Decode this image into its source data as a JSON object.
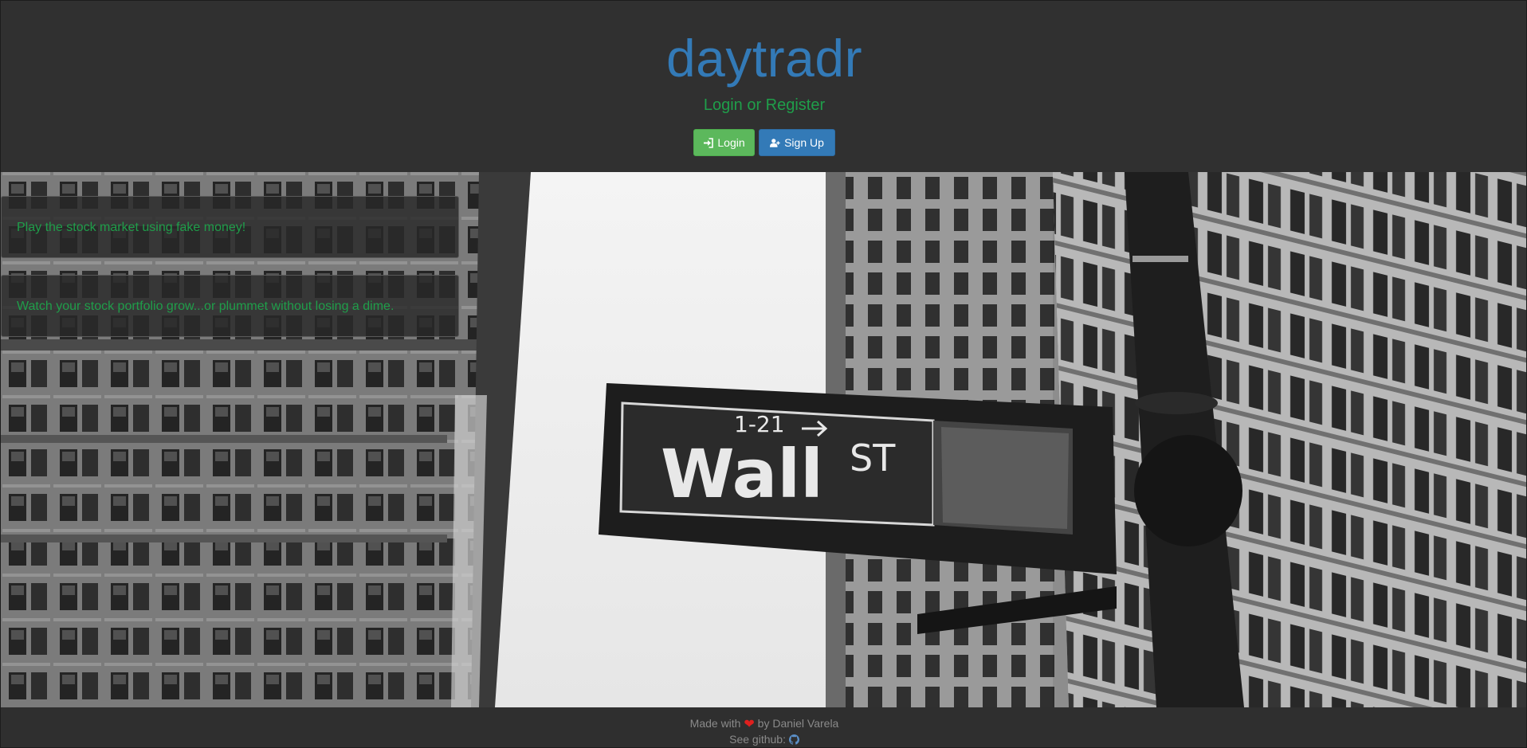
{
  "header": {
    "brand": "daytradr",
    "subtitle": "Login or Register",
    "login_label": "Login",
    "signup_label": "Sign Up",
    "login_icon": "sign-in-icon",
    "signup_icon": "user-plus-icon"
  },
  "hero": {
    "image": "wall-street-sign-photo",
    "sign_number": "1-21",
    "sign_name": "Wall",
    "sign_suffix": "ST",
    "features": [
      "Play the stock market using fake money!",
      "Watch your stock portfolio grow...or plummet without losing a dime."
    ]
  },
  "footer": {
    "made_with": "Made with",
    "by_text": "by Daniel Varela",
    "github_text": "See github:",
    "heart_icon": "heart-icon",
    "github_icon": "github-icon"
  },
  "colors": {
    "background": "#2f2f2f",
    "brand": "#337ab7",
    "accent_green": "#1f9e4a",
    "login_button": "#5cb85c",
    "signup_button": "#337ab7",
    "heart": "#e0201e"
  }
}
